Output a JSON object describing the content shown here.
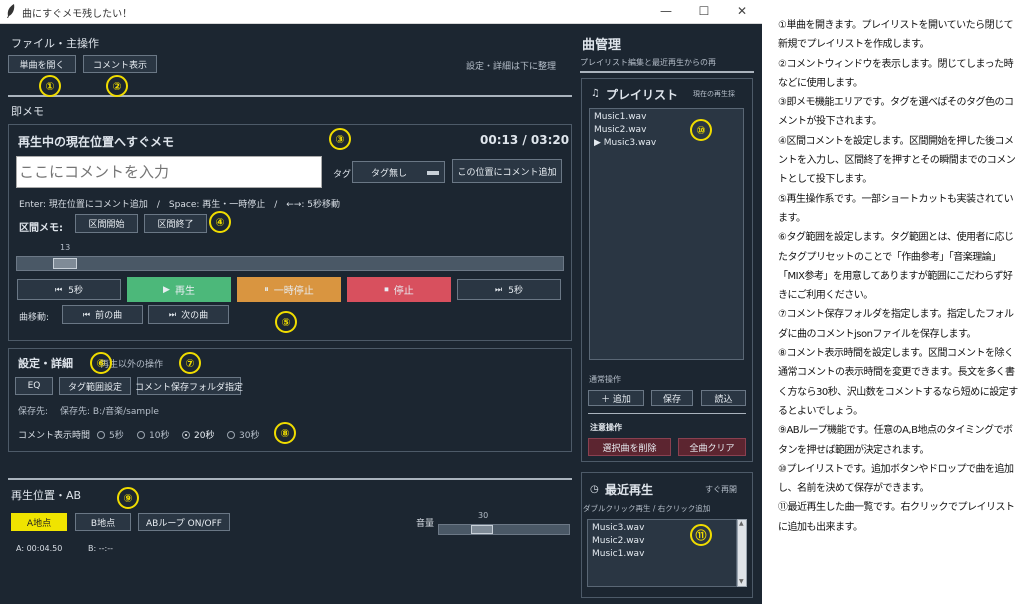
{
  "window": {
    "title": "曲にすぐメモ残したい！",
    "controls": [
      "—",
      "☐",
      "✕"
    ]
  },
  "file_section": {
    "header": "ファイル・主操作",
    "open_button": "単曲を開く",
    "comment_button": "コメント表示",
    "hint": "設定・詳細は下に整理"
  },
  "memo_section": {
    "header": "即メモ",
    "title": "再生中の現在位置へすぐメモ",
    "time": "00:13 / 03:20",
    "comment_placeholder": "ここにコメントを入力",
    "tag_label": "タグ",
    "tag_value": "タグ無し",
    "add_here_button": "この位置にコメント追加",
    "shortcut_hint": "Enter: 現在位置にコメント追加　/　Space: 再生・一時停止　/　←→: 5秒移動",
    "range_label": "区間メモ:",
    "range_start": "区間開始",
    "range_end": "区間終了",
    "seek_value": "13"
  },
  "transport": {
    "rewind": "5秒",
    "play": "再生",
    "pause": "一時停止",
    "stop": "停止",
    "forward": "5秒",
    "track_label": "曲移動:",
    "prev": "前の曲",
    "next": "次の曲"
  },
  "settings": {
    "header": "設定・詳細",
    "sub": "再生以外の操作",
    "eq": "EQ",
    "tag_range": "タグ範囲設定",
    "save_folder": "コメント保存フォルダ指定",
    "save_label": "保存先:",
    "save_path": "保存先: B:/音楽/sample",
    "duration_label": "コメント表示時間",
    "durations": [
      "5秒",
      "10秒",
      "20秒",
      "30秒"
    ],
    "duration_selected": "20秒"
  },
  "ab_section": {
    "header": "再生位置・AB",
    "a_button": "A地点",
    "b_button": "B地点",
    "loop_button": "ABループ ON/OFF",
    "volume_label": "音量",
    "volume_value": "30",
    "a_time": "A: 00:04.50",
    "b_time": "B: --:--"
  },
  "song_manager": {
    "header": "曲管理",
    "sub": "プレイリスト編集と最近再生からの再",
    "playlist_title": "プレイリスト",
    "playlist_sub": "現在の再生採",
    "playlist": [
      "Music1.wav",
      "Music2.wav",
      "▶ Music3.wav"
    ],
    "normal_ops": "通常操作",
    "add": "＋ 追加",
    "save": "保存",
    "load": "読込",
    "caution_ops": "注意操作",
    "delete_selected": "選択曲を削除",
    "clear_all": "全曲クリア",
    "recent_title": "最近再生",
    "recent_sub": "すぐ再開",
    "recent_hint": "ダブルクリック再生 / 右クリック追加",
    "recent": [
      "Music3.wav",
      "Music2.wav",
      "Music1.wav"
    ]
  },
  "markers": [
    "①",
    "②",
    "③",
    "④",
    "⑤",
    "⑥",
    "⑦",
    "⑧",
    "⑨",
    "⑩",
    "⑪"
  ],
  "description": [
    "①単曲を開きます。プレイリストを開いていたら閉じて新規でプレイリストを作成します。",
    "②コメントウィンドウを表示します。閉じてしまった時などに使用します。",
    "③即メモ機能エリアです。タグを選べばそのタグ色のコメントが投下されます。",
    "④区間コメントを設定します。区間開始を押した後コメントを入力し、区間終了を押すとその瞬間までのコメントとして投下します。",
    "⑤再生操作系です。一部ショートカットも実装されています。",
    "⑥タグ範囲を設定します。タグ範囲とは、使用者に応じたタグプリセットのことで「作曲参考」「音楽理論」「MIX参考」を用意してありますが範囲にこだわらず好きにご利用ください。",
    "⑦コメント保存フォルダを指定します。指定したフォルダに曲のコメントjsonファイルを保存します。",
    "⑧コメント表示時間を設定します。区間コメントを除く通常コメントの表示時間を変更できます。長文を多く書く方なら30秒、沢山数をコメントするなら短めに設定するとよいでしょう。",
    "⑨ABループ機能です。任意のA,B地点のタイミングでボタンを押せば範囲が決定されます。",
    "⑩プレイリストです。追加ボタンやドロップで曲を追加し、名前を決めて保存ができます。",
    "⑪最近再生した曲一覧です。右クリックでプレイリストに追加も出来ます。"
  ],
  "colors": {
    "bg": "#1c2631",
    "play": "#4cb87a",
    "pause": "#d99540",
    "stop": "#d8505e",
    "a_button": "#f0e400",
    "marker": "#f0dc00",
    "delete": "#5c2530"
  }
}
